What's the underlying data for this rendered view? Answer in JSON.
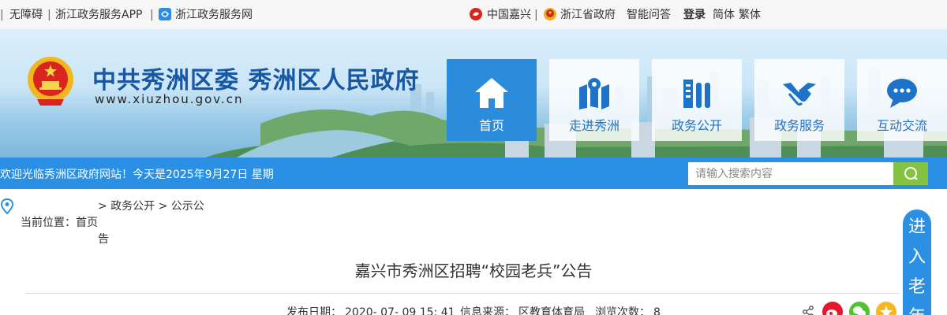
{
  "topbar": {
    "accessibility": "无障碍",
    "app": "浙江政务服务APP",
    "service_net": "浙江政务服务网",
    "china_jiaxing": "中国嘉兴",
    "zhejiang_gov": "浙江省政府",
    "qa": "智能问答",
    "login": "登录",
    "simplified": "简体",
    "traditional": "繁体"
  },
  "header": {
    "title": "中共秀洲区委 秀洲区人民政府",
    "url": "www.xiuzhou.gov.cn"
  },
  "nav": [
    {
      "label": "首页",
      "icon": "home-icon"
    },
    {
      "label": "走进秀洲",
      "icon": "map-pin-icon"
    },
    {
      "label": "政务公开",
      "icon": "document-columns-icon"
    },
    {
      "label": "政务服务",
      "icon": "handshake-icon"
    },
    {
      "label": "互动交流",
      "icon": "chat-bubble-icon"
    }
  ],
  "welcome": {
    "text": "欢迎光临秀洲区政府网站！今天是2025年9月27日 星期",
    "search_placeholder": "请输入搜索内容"
  },
  "breadcrumb": {
    "label": "当前位置：",
    "home_part1": "首页",
    "home_part2": "告",
    "path": "> 政务公开 > 公示公"
  },
  "article": {
    "title": "嘉兴市秀洲区招聘“校园老兵”公告",
    "publish_label": "发布日期：",
    "publish_date": "2020- 07- 09 15: 41",
    "source_label": "信息来源：",
    "source": "区教育体育局",
    "views_label": "浏览次数：",
    "views": "8"
  },
  "side_float": {
    "chars": [
      "进",
      "入",
      "老",
      "年"
    ]
  },
  "colors": {
    "primary_blue": "#2b8fe3",
    "title_blue": "#1757a3",
    "search_green": "#84c341",
    "weibo_red": "#e6162d",
    "wechat_green": "#51c332",
    "qzone_yellow": "#f5b823"
  }
}
